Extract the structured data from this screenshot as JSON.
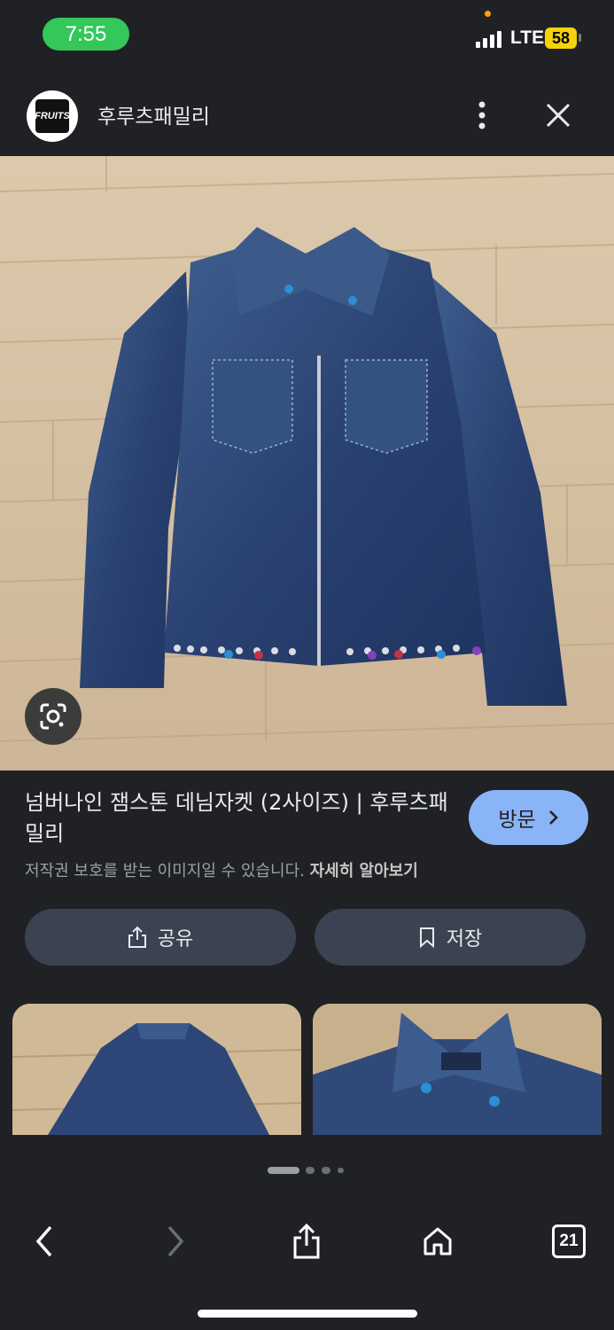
{
  "status_bar": {
    "time": "7:55",
    "network": "LTE",
    "battery": "58"
  },
  "header": {
    "site_name": "후루츠패밀리",
    "logo_text": "FRUITS"
  },
  "result": {
    "title": "넘버나인 잼스톤 데님자켓 (2사이즈) | 후루츠패밀리",
    "visit_label": "방문",
    "copyright_text": "저작권 보호를 받는 이미지일 수 있습니다.",
    "learn_more": "자세히 알아보기"
  },
  "actions": {
    "share_label": "공유",
    "save_label": "저장"
  },
  "pager": {
    "count": 4,
    "active": 0
  },
  "bottom_nav": {
    "tabs_count": "21"
  },
  "colors": {
    "background": "#202124",
    "accent": "#8ab4f8",
    "button_bg": "#3b4252",
    "time_pill": "#34c759",
    "battery": "#f5d20a"
  },
  "icons": [
    "more-vert-icon",
    "close-icon",
    "lens-icon",
    "share-icon",
    "bookmark-icon",
    "chevron-right-icon",
    "back-icon",
    "forward-icon",
    "share-up-icon",
    "home-icon",
    "tabs-icon"
  ]
}
